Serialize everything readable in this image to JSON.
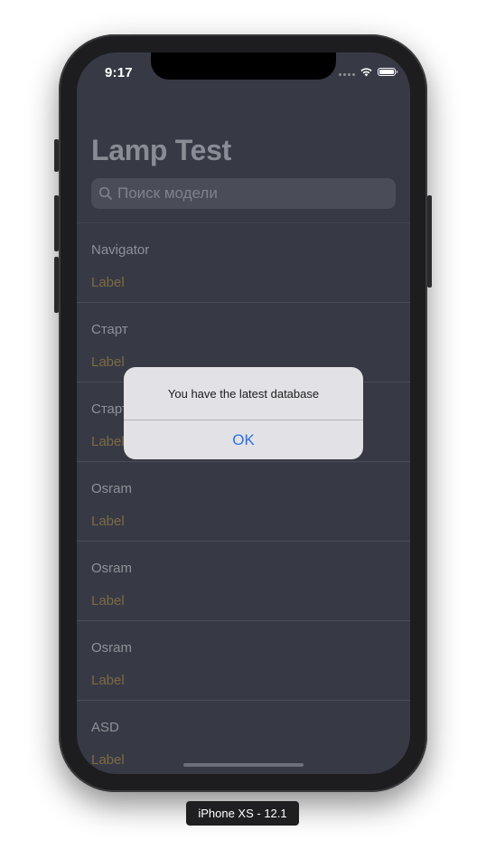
{
  "status_bar": {
    "time": "9:17"
  },
  "navigation": {
    "large_title": "Lamp Test"
  },
  "search": {
    "placeholder": "Поиск модели"
  },
  "list": {
    "items": [
      {
        "title": "Navigator",
        "subtitle": "Label"
      },
      {
        "title": "Старт",
        "subtitle": "Label"
      },
      {
        "title": "Старт",
        "subtitle": "Label"
      },
      {
        "title": "Osram",
        "subtitle": "Label"
      },
      {
        "title": "Osram",
        "subtitle": "Label"
      },
      {
        "title": "Osram",
        "subtitle": "Label"
      },
      {
        "title": "ASD",
        "subtitle": "Label"
      }
    ]
  },
  "alert": {
    "message": "You have the latest database",
    "ok_label": "OK"
  },
  "device": {
    "label": "iPhone XS - 12.1"
  },
  "colors": {
    "accent": "#2e6fe3",
    "subtitle": "#7d6a43",
    "background": "#373a45"
  }
}
